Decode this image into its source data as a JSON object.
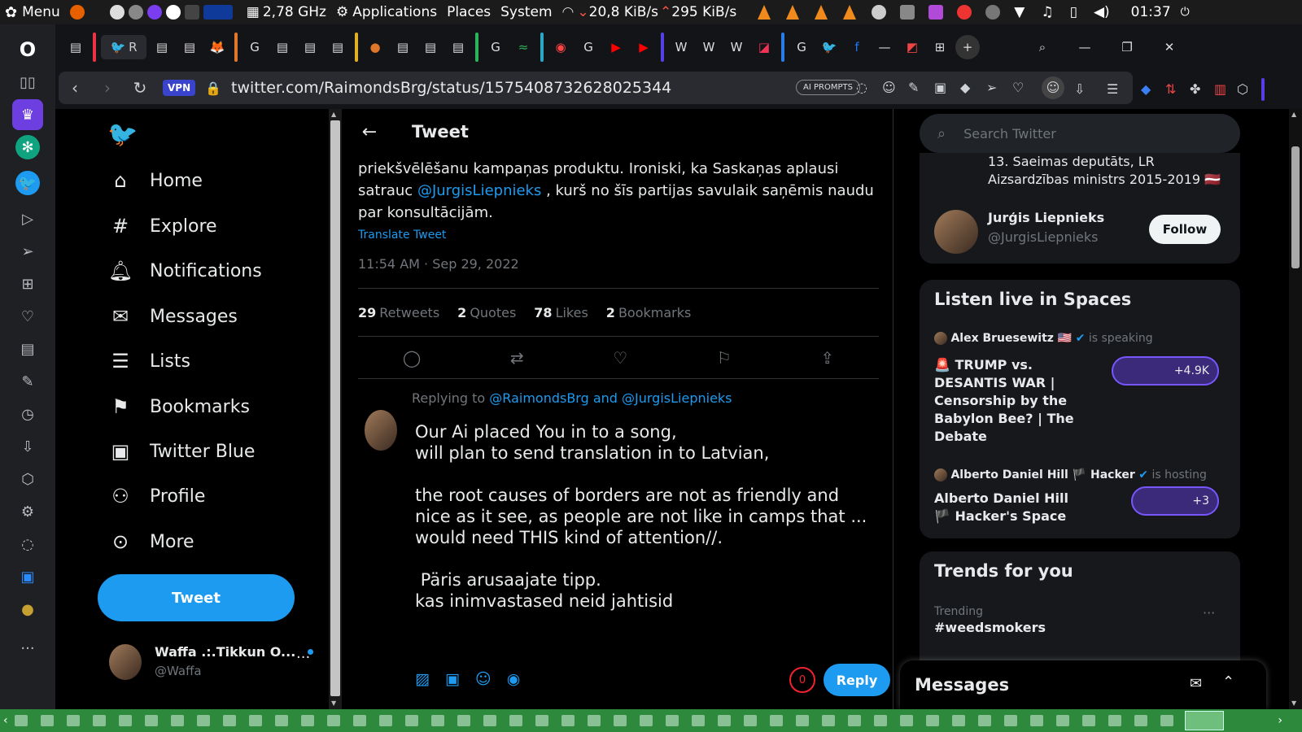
{
  "system_bar": {
    "menu_label": "Menu",
    "cpu_freq": "2,78 GHz",
    "applications": "Applications",
    "places": "Places",
    "system": "System",
    "net_down": "20,8 KiB/s",
    "net_up": "295 KiB/s",
    "clock": "01:37"
  },
  "browser": {
    "vpn_label": "VPN",
    "url": "twitter.com/RaimondsBrg/status/1575408732628025344",
    "ai_prompts": "AI PROMPTS",
    "tab_label_partial": "R"
  },
  "nav": {
    "items": [
      {
        "label": "Home",
        "icon": "home-icon"
      },
      {
        "label": "Explore",
        "icon": "hashtag-icon"
      },
      {
        "label": "Notifications",
        "icon": "bell-icon"
      },
      {
        "label": "Messages",
        "icon": "envelope-icon"
      },
      {
        "label": "Lists",
        "icon": "list-icon"
      },
      {
        "label": "Bookmarks",
        "icon": "bookmark-icon"
      },
      {
        "label": "Twitter Blue",
        "icon": "twitter-blue-icon"
      },
      {
        "label": "Profile",
        "icon": "person-icon"
      },
      {
        "label": "More",
        "icon": "more-circle-icon"
      }
    ],
    "tweet_button": "Tweet",
    "account_name": "Waffa .:.Tikkun O...",
    "account_handle": "@Waffa"
  },
  "tweet": {
    "header": "Tweet",
    "text_part1": "priekšvēlēšanu kampaņas produktu. Ironiski, ka Saskaņas aplausi satrauc ",
    "mention": "@JurgisLiepnieks",
    "text_part2": " , kurš no šīs partijas savulaik saņēmis naudu par konsultācijām.",
    "translate": "Translate Tweet",
    "timestamp": "11:54 AM · Sep 29, 2022",
    "stats": [
      {
        "count": "29",
        "label": "Retweets"
      },
      {
        "count": "2",
        "label": "Quotes"
      },
      {
        "count": "78",
        "label": "Likes"
      },
      {
        "count": "2",
        "label": "Bookmarks"
      }
    ]
  },
  "reply": {
    "replying_prefix": "Replying to ",
    "replying_to": "@RaimondsBrg and @JurgisLiepnieks",
    "text": "Our Ai placed You in to a song,\nwill plan to send translation in to Latvian,\n\nthe root causes of borders are not as friendly and nice as it see, as people are not like in camps that ... would need THIS kind of attention//.\n\n Päris arusaajate tipp.\nkas inimvastased neid jahtisid",
    "char_counter": "0",
    "reply_button": "Reply"
  },
  "sidebar": {
    "search_placeholder": "Search Twitter",
    "bio_text": "13. Saeimas deputāts, LR Aizsardzības ministrs 2015-2019 🇱🇻",
    "suggest_name": "Jurģis Liepnieks",
    "suggest_handle": "@JurgisLiepnieks",
    "follow_label": "Follow",
    "spaces_title": "Listen live in Spaces",
    "space1_host": "Alex Bruesewitz 🇺🇸",
    "space1_status": "is speaking",
    "space1_title": "🚨 TRUMP vs. DESANTIS WAR | Censorship by the Babylon Bee? | The Debate",
    "space1_count": "+4.9K",
    "space2_host": "Alberto Daniel Hill 🏴 Hacker",
    "space2_status": "is hosting",
    "space2_title": "Alberto Daniel Hill 🏴 Hacker's Space",
    "space2_count": "+3",
    "trends_title": "Trends for you",
    "trend_label": "Trending",
    "trend_tag": "#weedsmokers",
    "messages_label": "Messages"
  },
  "colors": {
    "accent": "#1d9bf0",
    "bg": "#000000",
    "taskbar": "#2d8a3c"
  }
}
